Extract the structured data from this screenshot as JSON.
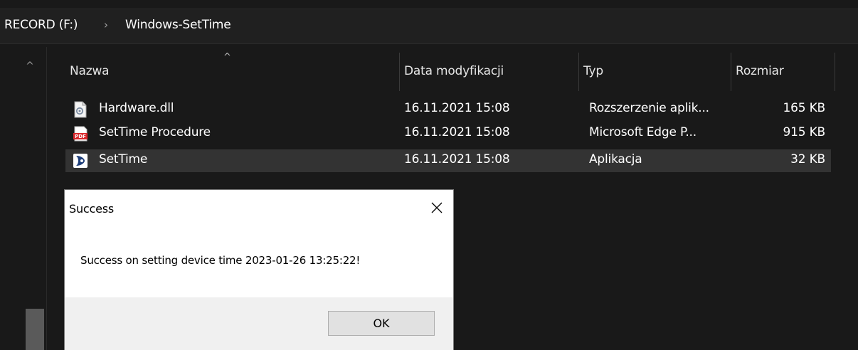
{
  "address_bar": {
    "crumbs": [
      "RECORD (F:)",
      "Windows-SetTime"
    ],
    "separator": "›"
  },
  "columns": {
    "name": "Nazwa",
    "date": "Data modyfikacji",
    "type": "Typ",
    "size": "Rozmiar",
    "sort_indicator": "^"
  },
  "files": [
    {
      "name": "Hardware.dll",
      "date": "16.11.2021 15:08",
      "type": "Rozszerzenie aplik...",
      "size": "165 KB",
      "icon": "dll-file-icon"
    },
    {
      "name": "SetTime Procedure",
      "date": "16.11.2021 15:08",
      "type": "Microsoft Edge P...",
      "size": "915 KB",
      "icon": "pdf-file-icon"
    },
    {
      "name": "SetTime",
      "date": "16.11.2021 15:08",
      "type": "Aplikacja",
      "size": "32 KB",
      "icon": "app-icon",
      "selected": true
    }
  ],
  "scroll": {
    "up_arrow": "^"
  },
  "dialog": {
    "title": "Success",
    "message": "Success on setting device time 2023-01-26 13:25:22!",
    "ok_label": "OK"
  },
  "colors": {
    "background": "#191919",
    "selected_row": "#333333",
    "dialog_footer": "#f0f0f0",
    "pdf_red": "#d9262b"
  }
}
